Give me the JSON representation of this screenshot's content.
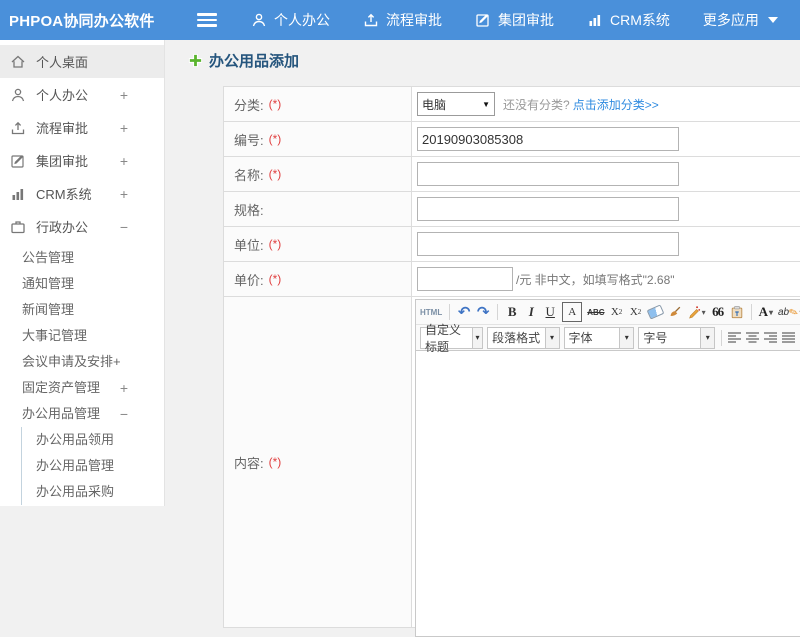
{
  "topbar": {
    "brand": "PHPOA协同办公软件",
    "nav_items": [
      {
        "label": "个人办公"
      },
      {
        "label": "流程审批"
      },
      {
        "label": "集团审批"
      },
      {
        "label": "CRM系统"
      },
      {
        "label": "更多应用"
      }
    ]
  },
  "sidebar": {
    "items": [
      {
        "label": "个人桌面",
        "suffix": ""
      },
      {
        "label": "个人办公",
        "suffix": "+"
      },
      {
        "label": "流程审批",
        "suffix": "+"
      },
      {
        "label": "集团审批",
        "suffix": "+"
      },
      {
        "label": "CRM系统",
        "suffix": "+"
      },
      {
        "label": "行政办公",
        "suffix": "−"
      }
    ],
    "admin_submenu": [
      {
        "label": "公告管理",
        "suffix": ""
      },
      {
        "label": "通知管理",
        "suffix": ""
      },
      {
        "label": "新闻管理",
        "suffix": ""
      },
      {
        "label": "大事记管理",
        "suffix": ""
      },
      {
        "label": "会议申请及安排+",
        "suffix": ""
      },
      {
        "label": "固定资产管理",
        "suffix": "+"
      },
      {
        "label": "办公用品管理",
        "suffix": "−"
      }
    ],
    "supplies_submenu": [
      {
        "label": "办公用品领用"
      },
      {
        "label": "办公用品管理"
      },
      {
        "label": "办公用品采购"
      }
    ]
  },
  "main": {
    "page_title": "办公用品添加",
    "form": {
      "category": {
        "label": "分类:",
        "required": "(*)",
        "selected_option": "电脑",
        "hint": "还没有分类?",
        "link": "点击添加分类>>"
      },
      "code": {
        "label": "编号:",
        "required": "(*)",
        "value": "20190903085308"
      },
      "name": {
        "label": "名称:",
        "required": "(*)",
        "value": ""
      },
      "spec": {
        "label": "规格:",
        "required": "",
        "value": ""
      },
      "unit": {
        "label": "单位:",
        "required": "(*)",
        "value": ""
      },
      "price": {
        "label": "单价:",
        "required": "(*)",
        "value": "",
        "hint": "/元 非中文，如填写格式\"2.68\""
      },
      "content": {
        "label": "内容:",
        "required": "(*)"
      }
    },
    "editor": {
      "html_button": "HTML",
      "bold": "B",
      "italic": "I",
      "underline": "U",
      "border_a": "A",
      "strike": "ABC",
      "sup_base": "X",
      "sup_mark": "2",
      "sub_base": "X",
      "sub_mark": "2",
      "quote": "66",
      "font_color": "A",
      "highlight": "ab",
      "combos": [
        {
          "label": "自定义标题"
        },
        {
          "label": "段落格式"
        },
        {
          "label": "字体"
        },
        {
          "label": "字号"
        }
      ]
    }
  },
  "colors": {
    "topbar_blue": "#4a90da",
    "link_blue": "#2f8be0",
    "required_red": "#e03e3e",
    "title_navy": "#25557d",
    "add_plus_green": "#5ab42e"
  }
}
